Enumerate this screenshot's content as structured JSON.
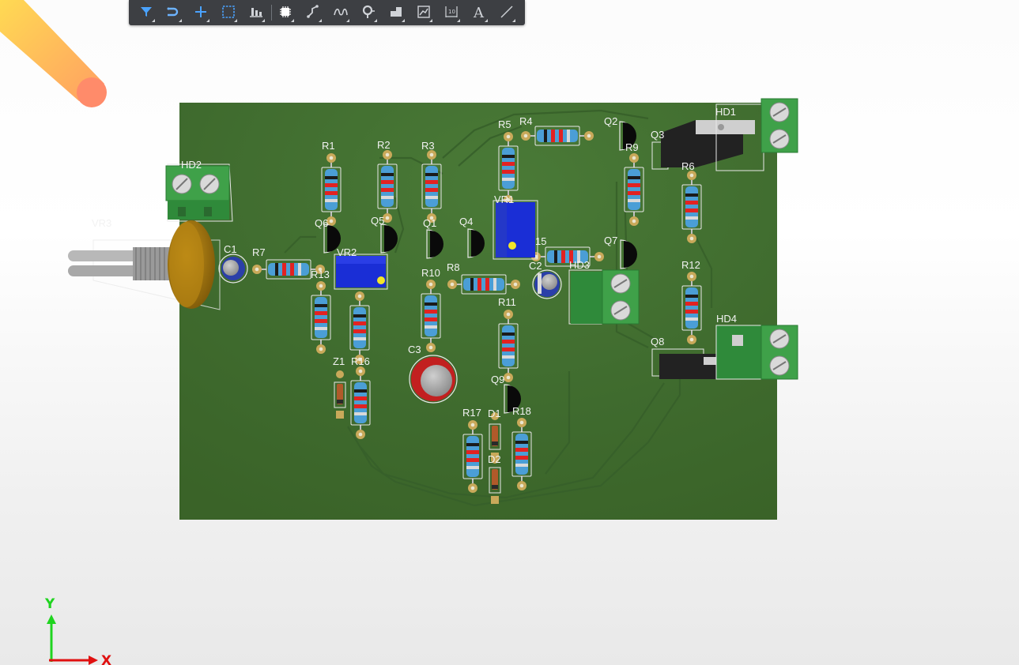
{
  "toolbar": {
    "buttons": [
      {
        "icon": "filter-icon",
        "color": "#4aa3ff"
      },
      {
        "icon": "route-icon",
        "color": "#6db3ff"
      },
      {
        "icon": "crosshair-icon",
        "color": "#4aa3ff"
      },
      {
        "icon": "select-rect-icon",
        "color": "#4aa3ff"
      },
      {
        "icon": "align-icon",
        "color": "#d0d3d8"
      },
      {
        "icon": "component-icon",
        "color": "#ffffff"
      },
      {
        "icon": "interactive-route-icon",
        "color": "#d0d3d8"
      },
      {
        "icon": "differential-pair-icon",
        "color": "#d0d3d8"
      },
      {
        "icon": "via-icon",
        "color": "#d0d3d8"
      },
      {
        "icon": "polygon-icon",
        "color": "#d0d3d8"
      },
      {
        "icon": "graph-icon",
        "color": "#d0d3d8"
      },
      {
        "icon": "dimension-icon",
        "color": "#d0d3d8"
      },
      {
        "icon": "text-icon",
        "color": "#d0d3d8"
      },
      {
        "icon": "line-icon",
        "color": "#d0d3d8"
      }
    ]
  },
  "board": {
    "color": "#3f6b2e",
    "silkscreen_color": "#f2f2f2",
    "labels": {
      "R1": "R1",
      "R2": "R2",
      "R3": "R3",
      "R4": "R4",
      "R5": "R5",
      "R6": "R6",
      "R7": "R7",
      "R8": "R8",
      "R9": "R9",
      "R10": "R10",
      "R11": "R11",
      "R12": "R12",
      "R13": "R13",
      "R15": "15",
      "R16": "R16",
      "R17": "R17",
      "R18": "R18",
      "Q1": "Q1",
      "Q2": "Q2",
      "Q3": "Q3",
      "Q4": "Q4",
      "Q5": "Q5",
      "Q6": "Q6",
      "Q7": "Q7",
      "Q8": "Q8",
      "Q9": "Q9",
      "C1": "C1",
      "C2": "C2",
      "C3": "C3",
      "D1": "D1",
      "D2": "D2",
      "Z1": "Z1",
      "VR1": "VR1",
      "VR2": "VR2",
      "VR3": "VR3",
      "HD1": "HD1",
      "HD2": "HD2",
      "HD3": "HD3",
      "HD4": "HD4"
    }
  },
  "axes": {
    "y_label": "Y",
    "x_label": "X",
    "y_color": "#1fd41f",
    "x_color": "#e01010"
  }
}
